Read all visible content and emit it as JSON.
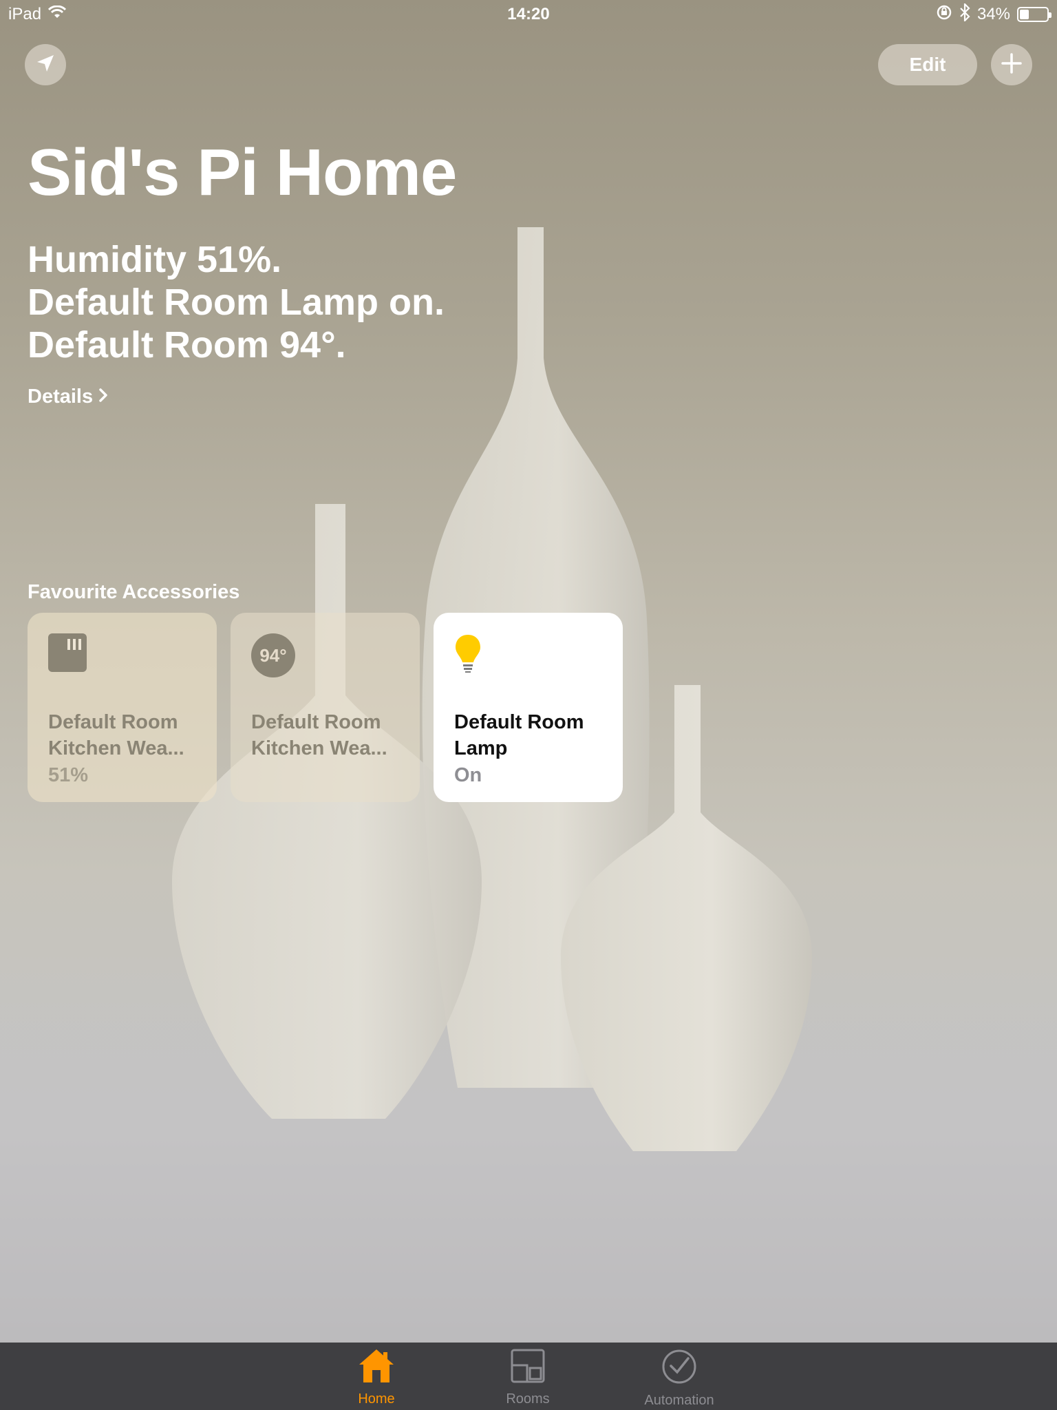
{
  "status_bar": {
    "device": "iPad",
    "time": "14:20",
    "battery": "34%",
    "battery_level": 0.34
  },
  "toolbar": {
    "location_icon": "location-arrow-icon",
    "edit_label": "Edit",
    "add_icon": "plus-icon"
  },
  "home": {
    "title": "Sid's Pi Home",
    "summary": [
      "Humidity 51%.",
      "Default Room Lamp on.",
      "Default Room 94°."
    ],
    "details_label": "Details"
  },
  "favourites": {
    "title": "Favourite Accessories",
    "tiles": [
      {
        "name": "Default Room Kitchen Wea...",
        "name_line1": "Default Room",
        "name_line2": "Kitchen Wea...",
        "status": "51%",
        "icon": "humidity-sensor-icon",
        "state": "off"
      },
      {
        "name": "Default Room Kitchen Wea...",
        "name_line1": "Default Room",
        "name_line2": "Kitchen Wea...",
        "status": "",
        "icon_text": "94°",
        "icon": "temperature-sensor-icon",
        "state": "off"
      },
      {
        "name": "Default Room Lamp",
        "name_line1": "Default Room",
        "name_line2": "Lamp",
        "status": "On",
        "icon": "lightbulb-icon",
        "state": "on"
      }
    ]
  },
  "tab_bar": {
    "tabs": [
      {
        "label": "Home",
        "icon": "house-icon",
        "active": true
      },
      {
        "label": "Rooms",
        "icon": "rooms-icon",
        "active": false
      },
      {
        "label": "Automation",
        "icon": "clock-check-icon",
        "active": false
      }
    ],
    "accent_color": "#ff9500"
  }
}
